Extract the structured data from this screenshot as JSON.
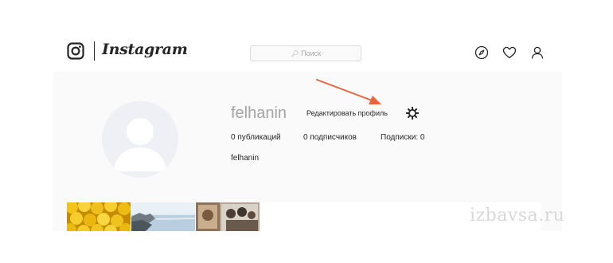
{
  "header": {
    "logo_text": "Instagram",
    "search_placeholder": "Поиск",
    "icons": [
      "instagram-logo-icon",
      "search-icon",
      "explore-icon",
      "heart-icon",
      "profile-icon"
    ]
  },
  "profile": {
    "username": "felhanin",
    "edit_button_label": "Редактировать профиль",
    "stats": {
      "posts": "0 публикаций",
      "followers": "0 подписчиков",
      "following": "Подписки: 0"
    },
    "full_name": "felhanin"
  },
  "watermark": "izbavsa.ru",
  "colors": {
    "accent_arrow": "#e8643c",
    "text": "#262626",
    "muted": "#a4a4a4",
    "border": "#dbdbdb"
  }
}
